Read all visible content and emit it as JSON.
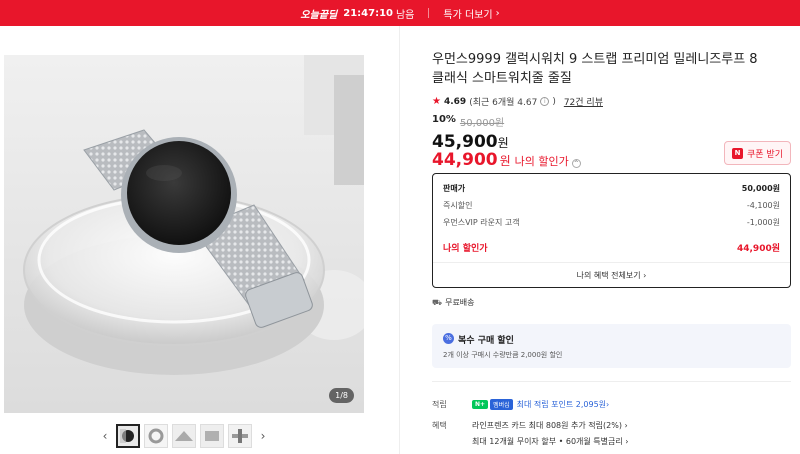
{
  "topbar": {
    "deal_label": "오늘끝딜",
    "timer": "21:47:10",
    "timer_suffix": "남음",
    "more_label": "특가 더보기",
    "bg_color": "#e8162b"
  },
  "gallery": {
    "pager": "1/8",
    "thumb_count": 5
  },
  "product": {
    "title": "우먼스9999 갤럭시워치 9 스트랩 프리미엄 밀레니즈루프 8 클래식 스마트워치줄 줄질",
    "rating": "4.69",
    "rating_recent": "(최근 6개월 4.67",
    "rating_recent_close": ")",
    "review_link": "72건 리뷰",
    "discount_rate": "10%",
    "original_price": "50,000원",
    "price": "45,900",
    "price_unit": "원",
    "my_price": "44,900",
    "my_price_unit": "원",
    "my_price_label": "나의 할인가",
    "coupon_label": "쿠폰 받기"
  },
  "price_box": {
    "rows": [
      {
        "label": "판매가",
        "value": "50,000원"
      },
      {
        "label": "즉시할인",
        "value": "-4,100원"
      },
      {
        "label": "우먼스VIP 라운지 고객",
        "value": "-1,000원"
      },
      {
        "label": "나의 할인가",
        "value": "44,900원"
      }
    ],
    "benefit_link": "나의 혜택 전체보기"
  },
  "shipping": {
    "label": "무료배송"
  },
  "multi_buy": {
    "title": "복수 구매 할인",
    "desc": "2개 이상 구매시 수량만큼 2,000원 할인"
  },
  "points": {
    "label": "적립",
    "badge1": "N+",
    "badge2": "멤버십",
    "value": "최대 적립 포인트 2,095원"
  },
  "benefits": {
    "label": "혜택",
    "line1": "라인프렌즈 카드 최대 808원 추가 적립(2%)",
    "line2": "최대 12개월 무이자 할부 • 60개월 특별금리"
  },
  "colors": {
    "accent": "#e8162b",
    "link_blue": "#2a63d8",
    "naver_green": "#03c75a"
  }
}
